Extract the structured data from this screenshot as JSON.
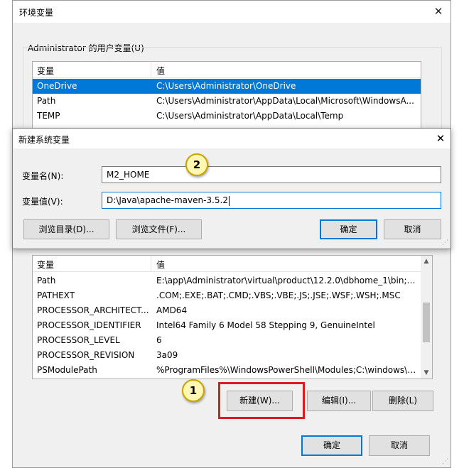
{
  "window": {
    "title": "环境变量"
  },
  "user_vars": {
    "group_label": "Administrator 的用户变量(U)",
    "col_variable": "变量",
    "col_value": "值",
    "rows": [
      {
        "name": "OneDrive",
        "value": "C:\\Users\\Administrator\\OneDrive"
      },
      {
        "name": "Path",
        "value": "C:\\Users\\Administrator\\AppData\\Local\\Microsoft\\WindowsA..."
      },
      {
        "name": "TEMP",
        "value": "C:\\Users\\Administrator\\AppData\\Local\\Temp"
      }
    ]
  },
  "system_vars": {
    "col_variable": "变量",
    "col_value": "值",
    "rows": [
      {
        "name": "Path",
        "value": "E:\\app\\Administrator\\virtual\\product\\12.2.0\\dbhome_1\\bin;C:..."
      },
      {
        "name": "PATHEXT",
        "value": ".COM;.EXE;.BAT;.CMD;.VBS;.VBE;.JS;.JSE;.WSF;.WSH;.MSC"
      },
      {
        "name": "PROCESSOR_ARCHITECT...",
        "value": "AMD64"
      },
      {
        "name": "PROCESSOR_IDENTIFIER",
        "value": "Intel64 Family 6 Model 58 Stepping 9, GenuineIntel"
      },
      {
        "name": "PROCESSOR_LEVEL",
        "value": "6"
      },
      {
        "name": "PROCESSOR_REVISION",
        "value": "3a09"
      },
      {
        "name": "PSModulePath",
        "value": "%ProgramFiles%\\WindowsPowerShell\\Modules;C:\\windows\\s..."
      }
    ],
    "buttons": {
      "new": "新建(W)...",
      "edit": "编辑(I)...",
      "delete": "删除(L)"
    }
  },
  "footer": {
    "ok": "确定",
    "cancel": "取消"
  },
  "dialog": {
    "title": "新建系统变量",
    "name_label": "变量名(N):",
    "name_value": "M2_HOME",
    "value_label": "变量值(V):",
    "value_value": "D:\\Java\\apache-maven-3.5.2",
    "browse_dir": "浏览目录(D)...",
    "browse_file": "浏览文件(F)...",
    "ok": "确定",
    "cancel": "取消"
  },
  "annotations": {
    "callout_1": "1",
    "callout_2": "2"
  },
  "colors": {
    "selection": "#0078d7",
    "highlight_box": "#e0191e",
    "callout_fill": "#fff7b3"
  }
}
